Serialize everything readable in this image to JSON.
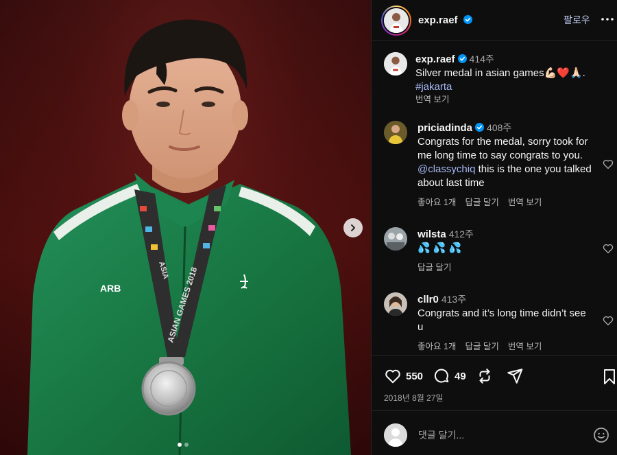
{
  "post": {
    "username": "exp.raef",
    "follow_label": "팔로우"
  },
  "caption": {
    "username": "exp.raef",
    "time": "414주",
    "text": "Silver medal in asian games",
    "emojis": "💪🏻❤️🙏🏻.",
    "hashtag": "#jakarta",
    "translate_label": "번역 보기"
  },
  "comments": [
    {
      "username": "priciadinda",
      "time": "408주",
      "text_before": "Congrats for the medal, sorry took for me long time to say congrats to you. ",
      "mention": "@classychiq",
      "text_after": " this is the one you talked about last time",
      "likes_label": "좋아요 1개",
      "reply_label": "답글 달기",
      "translate_label": "번역 보기"
    },
    {
      "username": "wilsta",
      "time": "412주",
      "text": "💦 💦 💦",
      "reply_label": "답글 달기"
    },
    {
      "username": "cllr0",
      "time": "413주",
      "text": "Congrats and it’s long time didn’t see u",
      "likes_label": "좋아요 1개",
      "reply_label": "답글 달기",
      "translate_label": "번역 보기"
    }
  ],
  "stats": {
    "likes": "550",
    "comments": "49",
    "date": "2018년 8월 27일"
  },
  "composer": {
    "placeholder": "댓글 달기..."
  },
  "media": {
    "medal_ribbon_text": "ASIAN GAMES 2018",
    "jacket_logo": "ARB",
    "slide_count": 2,
    "active_slide": 1
  },
  "colors": {
    "panel_bg": "#0e0e0e",
    "link": "#a6b8f5",
    "verified": "#0095f6",
    "jacket": "#1a7a45"
  }
}
